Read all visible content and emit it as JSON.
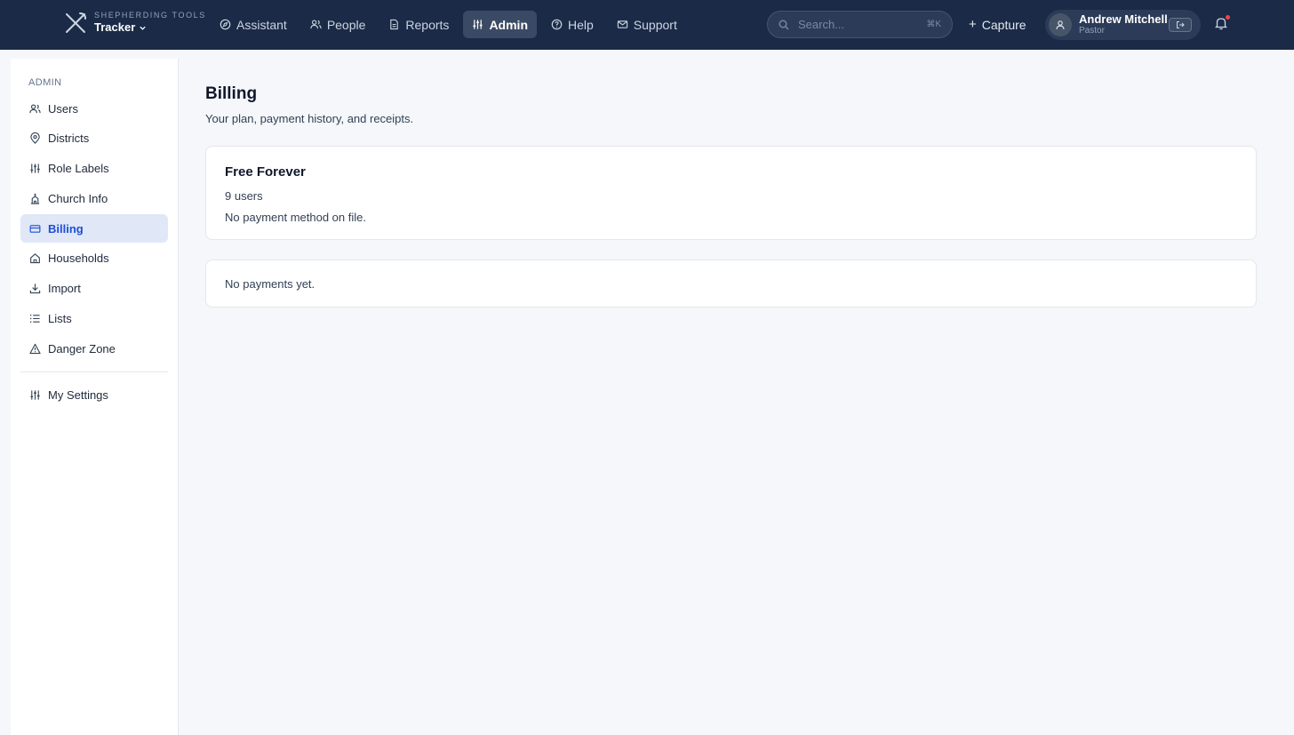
{
  "brand": {
    "supertitle": "SHEPHERDING TOOLS",
    "name": "Tracker"
  },
  "nav": {
    "items": [
      {
        "label": "Assistant",
        "icon": "compass-icon"
      },
      {
        "label": "People",
        "icon": "users-icon"
      },
      {
        "label": "Reports",
        "icon": "document-icon"
      },
      {
        "label": "Admin",
        "icon": "sliders-icon",
        "active": true
      },
      {
        "label": "Help",
        "icon": "help-circle-icon"
      },
      {
        "label": "Support",
        "icon": "mail-icon"
      }
    ]
  },
  "search": {
    "placeholder": "Search...",
    "shortcut": "⌘K"
  },
  "capture": {
    "label": "Capture"
  },
  "user": {
    "name": "Andrew Mitchell",
    "role": "Pastor"
  },
  "sidebar": {
    "heading": "ADMIN",
    "items": [
      {
        "label": "Users",
        "icon": "users-icon"
      },
      {
        "label": "Districts",
        "icon": "map-pin-icon"
      },
      {
        "label": "Role Labels",
        "icon": "sliders-icon"
      },
      {
        "label": "Church Info",
        "icon": "church-icon"
      },
      {
        "label": "Billing",
        "icon": "credit-card-icon",
        "active": true
      },
      {
        "label": "Households",
        "icon": "home-icon"
      },
      {
        "label": "Import",
        "icon": "download-icon"
      },
      {
        "label": "Lists",
        "icon": "list-icon"
      },
      {
        "label": "Danger Zone",
        "icon": "warning-icon"
      }
    ],
    "settings": {
      "label": "My Settings",
      "icon": "sliders-icon"
    }
  },
  "page": {
    "title": "Billing",
    "subtitle": "Your plan, payment history, and receipts."
  },
  "plan": {
    "name": "Free Forever",
    "users": "9 users",
    "payment_method": "No payment method on file."
  },
  "payments": {
    "empty_text": "No payments yet."
  },
  "colors": {
    "topbar": "#1b2a47",
    "accent": "#1d4ed8",
    "active_bg": "#e0e7f6",
    "notification_dot": "#ef4444"
  }
}
